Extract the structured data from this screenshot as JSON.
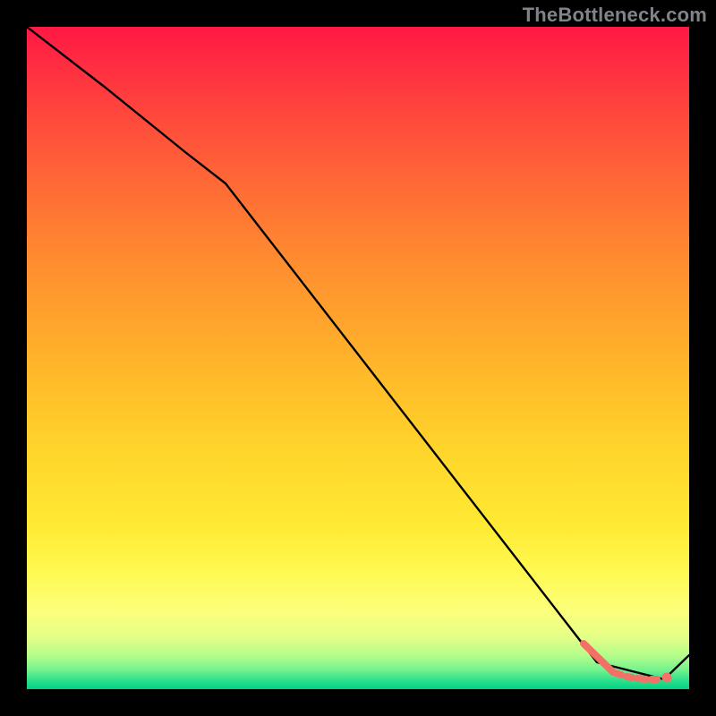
{
  "watermark": "TheBottleneck.com",
  "chart_data": {
    "type": "line",
    "title": "",
    "xlabel": "",
    "ylabel": "",
    "xlim": [
      0,
      100
    ],
    "ylim": [
      0,
      100
    ],
    "series": [
      {
        "name": "black-curve",
        "x": [
          0,
          12,
          24,
          30,
          86,
          96,
          100
        ],
        "y": [
          100,
          91,
          81,
          76,
          4,
          1.5,
          5
        ]
      }
    ],
    "markers": {
      "solid_segment": {
        "x": [
          84,
          88.5
        ],
        "y": [
          7,
          2.5
        ]
      },
      "dashed_segment": {
        "x": [
          88.5,
          96
        ],
        "y": [
          2,
          1.5
        ]
      },
      "end_point": {
        "x": 96.5,
        "y": 1.8
      }
    },
    "gradient_stops": [
      {
        "pos": 0.0,
        "color": "#ff1843"
      },
      {
        "pos": 0.5,
        "color": "#ffc52a"
      },
      {
        "pos": 0.82,
        "color": "#fff94f"
      },
      {
        "pos": 1.0,
        "color": "#00d285"
      }
    ]
  }
}
